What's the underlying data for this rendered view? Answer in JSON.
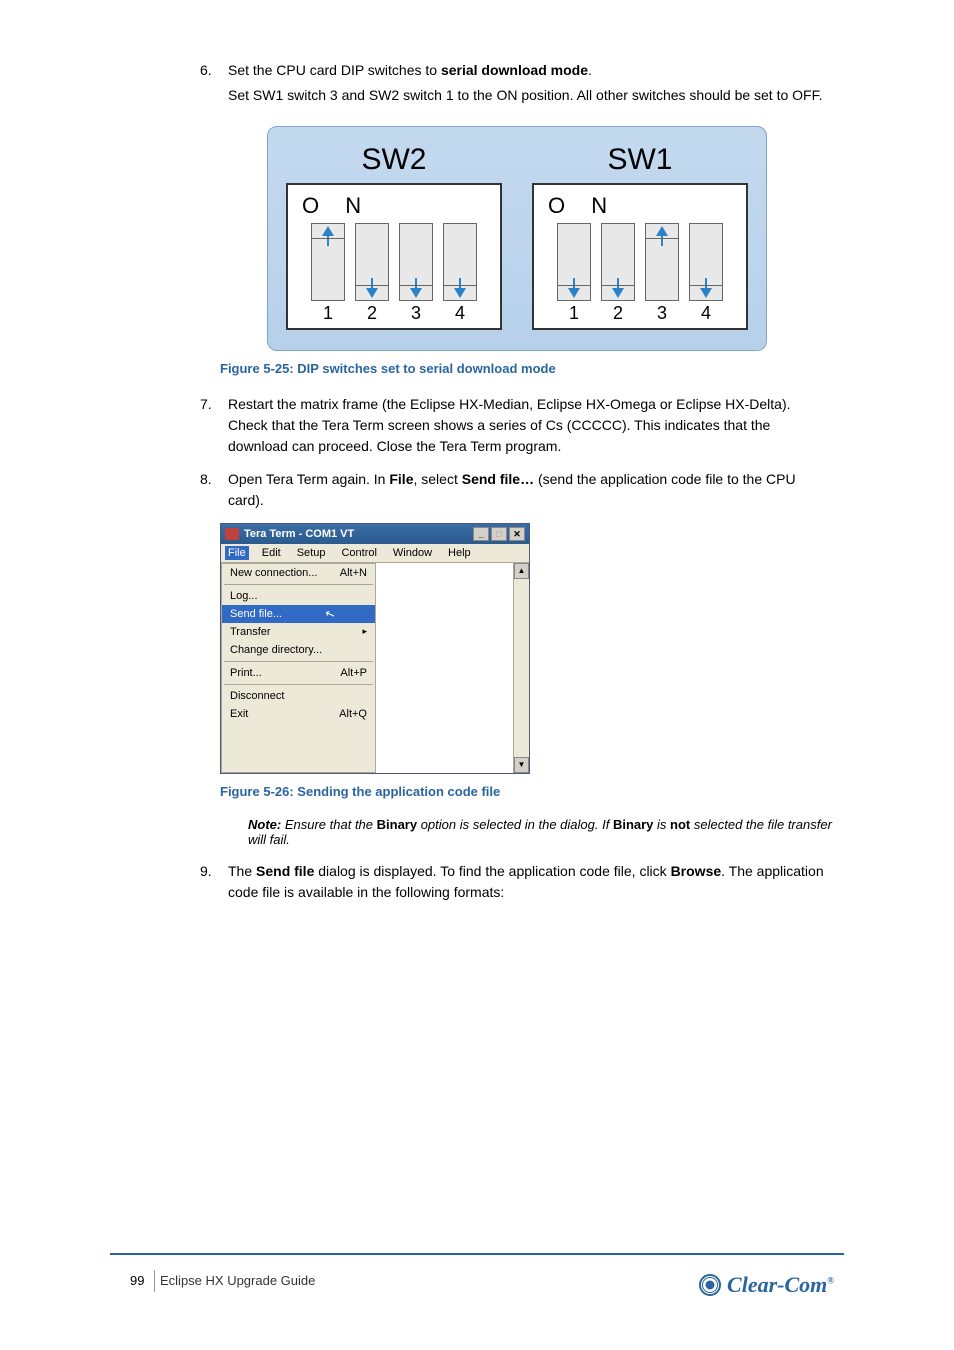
{
  "steps": {
    "s6": {
      "num": "6.",
      "line1_prefix": "Set the CPU card DIP switches to ",
      "line1_bold": "serial download mode",
      "line1_suffix": ".",
      "line2": "Set SW1 switch 3 and SW2 switch 1 to the ON position. All other switches should be set to OFF."
    },
    "s7": {
      "num": "7.",
      "text": "Restart the matrix frame (the Eclipse HX-Median, Eclipse HX-Omega or Eclipse HX-Delta). Check that the Tera Term screen shows a series of Cs (CCCCC). This indicates that the download can proceed. Close the Tera Term program."
    },
    "s8": {
      "num": "8.",
      "text_prefix": "Open Tera Term again. In ",
      "text_bold": "File",
      "text_mid": ", select ",
      "text_bold2": "Send file…",
      "text_suffix": " (send the application code file to the CPU card)."
    }
  },
  "dip": {
    "sw2": {
      "title": "SW2",
      "on": "O N",
      "labels": [
        "1",
        "2",
        "3",
        "4"
      ],
      "positions": [
        "up",
        "down",
        "down",
        "down"
      ]
    },
    "sw1": {
      "title": "SW1",
      "on": "O N",
      "labels": [
        "1",
        "2",
        "3",
        "4"
      ],
      "positions": [
        "down",
        "down",
        "up",
        "down"
      ]
    }
  },
  "fig1": {
    "caption": "Figure 5-25: DIP switches set to serial download mode"
  },
  "teraterm": {
    "title": "Tera Term - COM1 VT",
    "menus": [
      "File",
      "Edit",
      "Setup",
      "Control",
      "Window",
      "Help"
    ],
    "items": [
      {
        "label": "New connection...",
        "shortcut": "Alt+N"
      },
      {
        "sep": true
      },
      {
        "label": "Log..."
      },
      {
        "label": "Send file...",
        "highlight": true
      },
      {
        "label": "Transfer",
        "submenu": true
      },
      {
        "label": "Change directory..."
      },
      {
        "sep": true
      },
      {
        "label": "Print...",
        "shortcut": "Alt+P"
      },
      {
        "sep": true
      },
      {
        "label": "Disconnect"
      },
      {
        "label": "Exit",
        "shortcut": "Alt+Q"
      }
    ],
    "winbtns": {
      "min": "_",
      "max": "□",
      "close": "✕"
    },
    "scroll_up": "▲",
    "scroll_down": "▼"
  },
  "fig2": {
    "caption": "Figure 5-26: Sending the application code file"
  },
  "note": {
    "label": "Note:",
    "part1": "Ensure that the ",
    "bold1": "Binary",
    "part2": " option is selected in the dialog. If ",
    "bold2": "Binary",
    "part3": " is ",
    "bold3": "not",
    "part4": " selected the file transfer will fail."
  },
  "steps_after": {
    "s9": {
      "num": "9.",
      "text_prefix": "The ",
      "bold": "Send file",
      "text_mid": " dialog is displayed. To find the application code file, click ",
      "bold2": "Browse",
      "text_suffix": ". The application code file is available in the following formats:"
    }
  },
  "footer": {
    "page": "99",
    "guide": "Eclipse HX Upgrade Guide",
    "brand": "Clear-Com",
    "reg": "®"
  }
}
